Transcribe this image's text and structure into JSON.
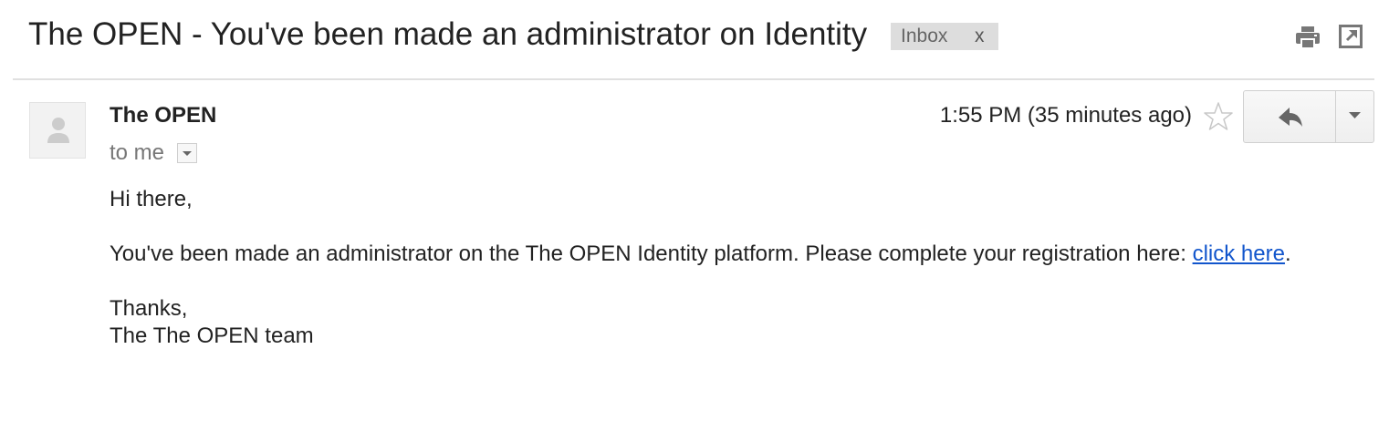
{
  "header": {
    "subject": "The OPEN - You've been made an administrator on Identity",
    "label": "Inbox",
    "label_remove": "x",
    "icons": [
      "print-icon",
      "open-in-new-window-icon"
    ]
  },
  "message": {
    "sender": "The OPEN",
    "recipient_prefix": "to me",
    "time": "1:55 PM (35 minutes ago)",
    "starred": false,
    "icons": [
      "avatar-placeholder-icon",
      "chevron-down-icon",
      "star-icon",
      "reply-arrow-icon",
      "dropdown-arrow-icon"
    ]
  },
  "body": {
    "greeting": "Hi there,",
    "message_text": "You've been made an administrator on the The OPEN Identity platform. Please complete your registration here: ",
    "link_text": "click here",
    "message_end": ".",
    "signoff": "Thanks,",
    "signature": "The The OPEN team"
  },
  "colors": {
    "link": "#1155cc",
    "label_bg": "#dddddd",
    "text": "#222222",
    "muted": "#777777"
  }
}
